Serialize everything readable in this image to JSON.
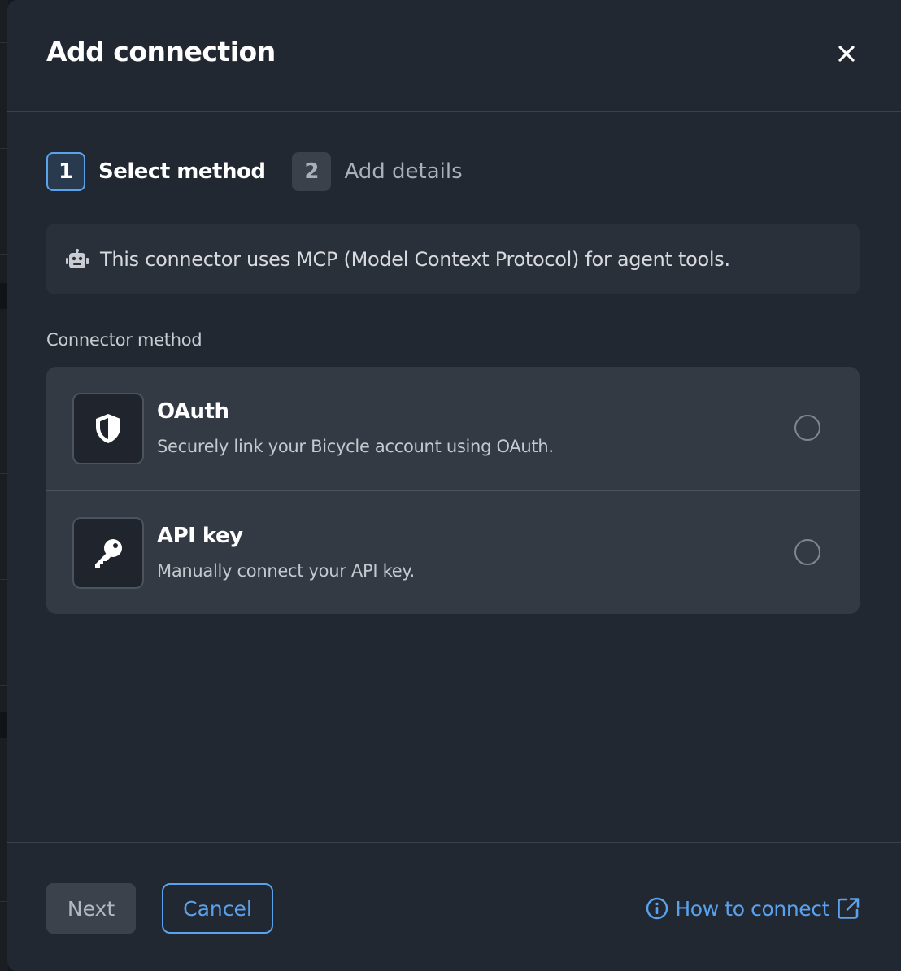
{
  "modal": {
    "title": "Add connection",
    "close_icon": "close-icon"
  },
  "stepper": {
    "steps": [
      {
        "number": "1",
        "label": "Select method",
        "state": "active"
      },
      {
        "number": "2",
        "label": "Add details",
        "state": "inactive"
      }
    ]
  },
  "info": {
    "icon": "robot-icon",
    "text": "This connector uses MCP (Model Context Protocol) for agent tools."
  },
  "connector_method": {
    "label": "Connector method",
    "options": [
      {
        "icon": "shield-icon",
        "title": "OAuth",
        "description": "Securely link your Bicycle account using OAuth.",
        "selected": false
      },
      {
        "icon": "key-icon",
        "title": "API key",
        "description": "Manually connect your API key.",
        "selected": false
      }
    ]
  },
  "footer": {
    "next_label": "Next",
    "cancel_label": "Cancel",
    "help_label": "How to connect",
    "help_icon": "info-icon",
    "external_icon": "external-link-icon"
  },
  "colors": {
    "accent": "#5aa2ee",
    "modal_bg": "#222831",
    "card_bg": "#333a44"
  }
}
